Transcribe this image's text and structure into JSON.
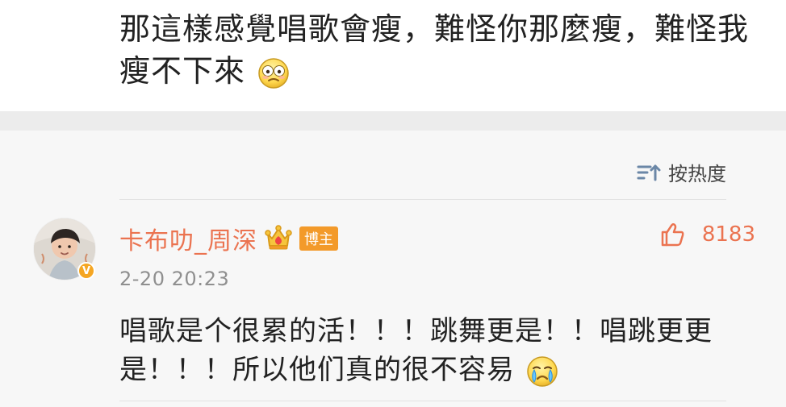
{
  "post": {
    "text": "那這樣感覺唱歌會瘦，難怪你那麼瘦，難怪我瘦不下來",
    "emoji_name": "flushed-face-icon"
  },
  "comments_header": {
    "sort_label": "按热度",
    "sort_icon": "sort-icon"
  },
  "comment": {
    "username": "卡布叻_周深",
    "badge_label": "博主",
    "likes": "8183",
    "timestamp": "2-20 20:23",
    "text": "唱歌是个很累的活！！！跳舞更是！！唱跳更更是！！！所以他们真的很不容易",
    "emoji_name": "crying-face-icon",
    "avatar_verified_label": "V"
  },
  "colors": {
    "accent": "#eb7350",
    "badge": "#f39a2a",
    "separator": "#ececec",
    "comment_bg": "#f7f7f7",
    "text": "#222222",
    "muted": "#8f8f8f"
  }
}
